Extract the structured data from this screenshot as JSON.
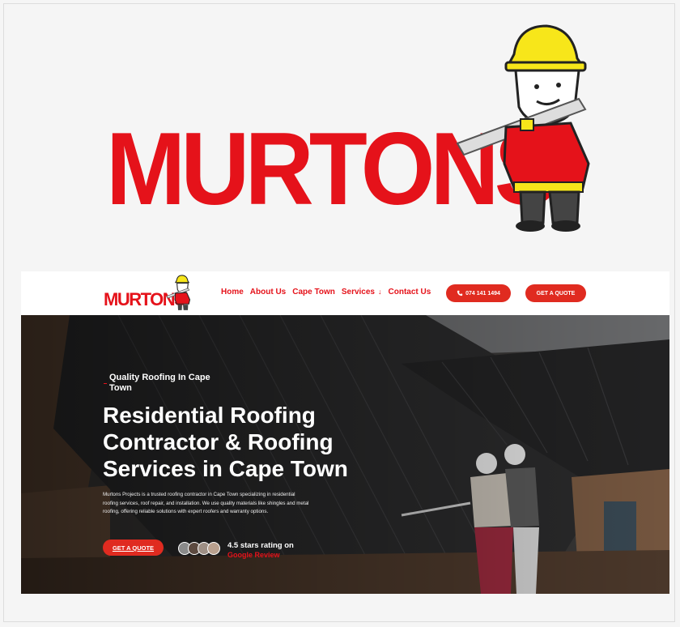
{
  "brand": {
    "logo_text": "MURTONS",
    "red": "#e5121a"
  },
  "nav": {
    "links": [
      "Home",
      "About Us",
      "Cape Town",
      "Services",
      "Contact Us"
    ],
    "services_arrow": "↓",
    "phone_button": "074 141 1494",
    "quote_button": "GET A QUOTE"
  },
  "hero": {
    "eyebrow": "Quality Roofing In Cape Town",
    "headline": "Residential Roofing Contractor & Roofing Services in Cape Town",
    "paragraph": "Murtons Projects is a trusted roofing contractor in Cape Town  specializing in residential roofing services, roof repair, and installation. We use quality materials like shingles and metal roofing, offering reliable solutions with expert roofers and warranty options.",
    "cta": "GET A QUOTE",
    "rating_text": "4.5 stars rating on",
    "review_text": "Google Review"
  },
  "icons": {
    "phone": "phone-icon",
    "mascot": "builder-mascot"
  }
}
